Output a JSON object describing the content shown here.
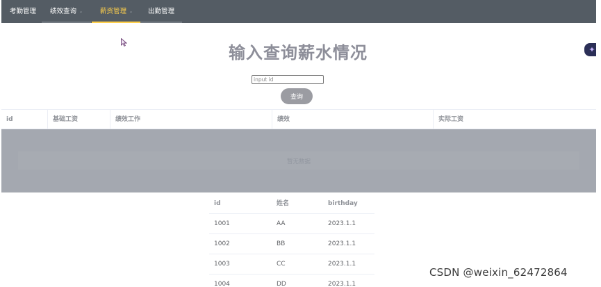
{
  "nav": {
    "items": [
      {
        "label": "考勤管理"
      },
      {
        "label": "绩效查询",
        "caret": "⌄"
      },
      {
        "label": "薪资管理",
        "caret": "⌄"
      },
      {
        "label": "出勤管理"
      }
    ],
    "active_color": "#ffd04b",
    "background": "#545c64"
  },
  "main": {
    "title": "输入查询薪水情况",
    "search": {
      "placeholder": "input id",
      "value": "",
      "button_label": "查询"
    }
  },
  "salary_table": {
    "columns": [
      "id",
      "基础工资",
      "绩效工作",
      "绩效",
      "实际工资"
    ],
    "empty_text": "暂无数据"
  },
  "person_table": {
    "columns": [
      "id",
      "姓名",
      "birthday"
    ],
    "rows": [
      [
        "1001",
        "AA",
        "2023.1.1"
      ],
      [
        "1002",
        "BB",
        "2023.1.1"
      ],
      [
        "1003",
        "CC",
        "2023.1.1"
      ],
      [
        "1004",
        "DD",
        "2023.1.1"
      ]
    ]
  },
  "overlay": {
    "float_icon": "sparkle-icon",
    "watermark": "CSDN @weixin_62472864"
  }
}
